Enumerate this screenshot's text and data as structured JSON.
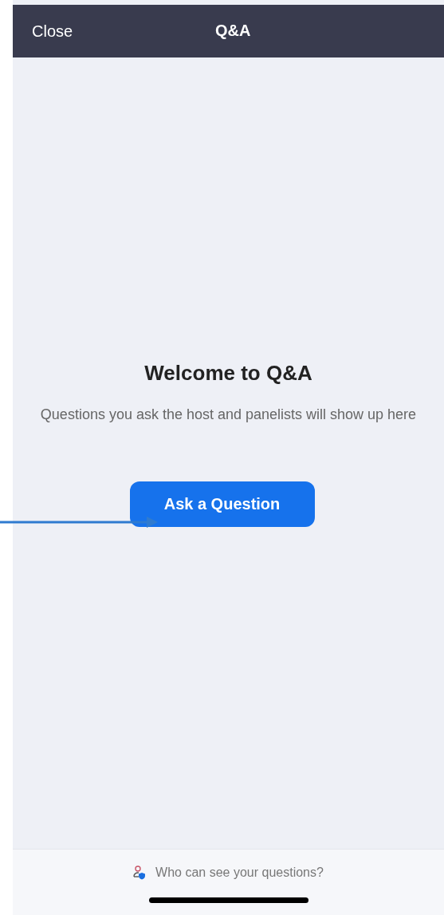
{
  "header": {
    "close": "Close",
    "title": "Q&A"
  },
  "empty_state": {
    "heading": "Welcome to Q&A",
    "message": "Questions you ask the host and panelists will show up here",
    "button": "Ask a Question"
  },
  "footer": {
    "link": "Who can see your questions?"
  }
}
